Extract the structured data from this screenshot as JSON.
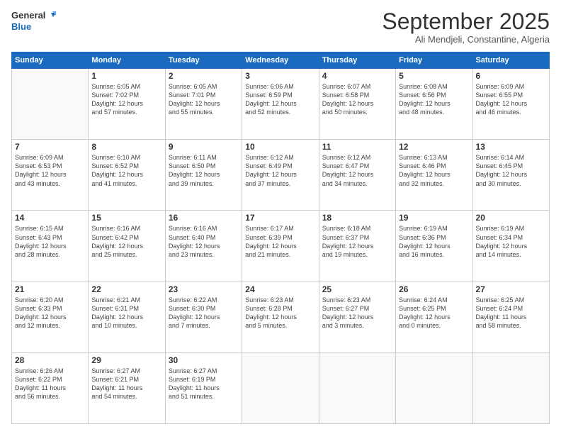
{
  "header": {
    "logo_line1": "General",
    "logo_line2": "Blue",
    "month_title": "September 2025",
    "subtitle": "Ali Mendjeli, Constantine, Algeria"
  },
  "days_of_week": [
    "Sunday",
    "Monday",
    "Tuesday",
    "Wednesday",
    "Thursday",
    "Friday",
    "Saturday"
  ],
  "weeks": [
    [
      {
        "day": "",
        "info": ""
      },
      {
        "day": "1",
        "info": "Sunrise: 6:05 AM\nSunset: 7:02 PM\nDaylight: 12 hours\nand 57 minutes."
      },
      {
        "day": "2",
        "info": "Sunrise: 6:05 AM\nSunset: 7:01 PM\nDaylight: 12 hours\nand 55 minutes."
      },
      {
        "day": "3",
        "info": "Sunrise: 6:06 AM\nSunset: 6:59 PM\nDaylight: 12 hours\nand 52 minutes."
      },
      {
        "day": "4",
        "info": "Sunrise: 6:07 AM\nSunset: 6:58 PM\nDaylight: 12 hours\nand 50 minutes."
      },
      {
        "day": "5",
        "info": "Sunrise: 6:08 AM\nSunset: 6:56 PM\nDaylight: 12 hours\nand 48 minutes."
      },
      {
        "day": "6",
        "info": "Sunrise: 6:09 AM\nSunset: 6:55 PM\nDaylight: 12 hours\nand 46 minutes."
      }
    ],
    [
      {
        "day": "7",
        "info": "Sunrise: 6:09 AM\nSunset: 6:53 PM\nDaylight: 12 hours\nand 43 minutes."
      },
      {
        "day": "8",
        "info": "Sunrise: 6:10 AM\nSunset: 6:52 PM\nDaylight: 12 hours\nand 41 minutes."
      },
      {
        "day": "9",
        "info": "Sunrise: 6:11 AM\nSunset: 6:50 PM\nDaylight: 12 hours\nand 39 minutes."
      },
      {
        "day": "10",
        "info": "Sunrise: 6:12 AM\nSunset: 6:49 PM\nDaylight: 12 hours\nand 37 minutes."
      },
      {
        "day": "11",
        "info": "Sunrise: 6:12 AM\nSunset: 6:47 PM\nDaylight: 12 hours\nand 34 minutes."
      },
      {
        "day": "12",
        "info": "Sunrise: 6:13 AM\nSunset: 6:46 PM\nDaylight: 12 hours\nand 32 minutes."
      },
      {
        "day": "13",
        "info": "Sunrise: 6:14 AM\nSunset: 6:45 PM\nDaylight: 12 hours\nand 30 minutes."
      }
    ],
    [
      {
        "day": "14",
        "info": "Sunrise: 6:15 AM\nSunset: 6:43 PM\nDaylight: 12 hours\nand 28 minutes."
      },
      {
        "day": "15",
        "info": "Sunrise: 6:16 AM\nSunset: 6:42 PM\nDaylight: 12 hours\nand 25 minutes."
      },
      {
        "day": "16",
        "info": "Sunrise: 6:16 AM\nSunset: 6:40 PM\nDaylight: 12 hours\nand 23 minutes."
      },
      {
        "day": "17",
        "info": "Sunrise: 6:17 AM\nSunset: 6:39 PM\nDaylight: 12 hours\nand 21 minutes."
      },
      {
        "day": "18",
        "info": "Sunrise: 6:18 AM\nSunset: 6:37 PM\nDaylight: 12 hours\nand 19 minutes."
      },
      {
        "day": "19",
        "info": "Sunrise: 6:19 AM\nSunset: 6:36 PM\nDaylight: 12 hours\nand 16 minutes."
      },
      {
        "day": "20",
        "info": "Sunrise: 6:19 AM\nSunset: 6:34 PM\nDaylight: 12 hours\nand 14 minutes."
      }
    ],
    [
      {
        "day": "21",
        "info": "Sunrise: 6:20 AM\nSunset: 6:33 PM\nDaylight: 12 hours\nand 12 minutes."
      },
      {
        "day": "22",
        "info": "Sunrise: 6:21 AM\nSunset: 6:31 PM\nDaylight: 12 hours\nand 10 minutes."
      },
      {
        "day": "23",
        "info": "Sunrise: 6:22 AM\nSunset: 6:30 PM\nDaylight: 12 hours\nand 7 minutes."
      },
      {
        "day": "24",
        "info": "Sunrise: 6:23 AM\nSunset: 6:28 PM\nDaylight: 12 hours\nand 5 minutes."
      },
      {
        "day": "25",
        "info": "Sunrise: 6:23 AM\nSunset: 6:27 PM\nDaylight: 12 hours\nand 3 minutes."
      },
      {
        "day": "26",
        "info": "Sunrise: 6:24 AM\nSunset: 6:25 PM\nDaylight: 12 hours\nand 0 minutes."
      },
      {
        "day": "27",
        "info": "Sunrise: 6:25 AM\nSunset: 6:24 PM\nDaylight: 11 hours\nand 58 minutes."
      }
    ],
    [
      {
        "day": "28",
        "info": "Sunrise: 6:26 AM\nSunset: 6:22 PM\nDaylight: 11 hours\nand 56 minutes."
      },
      {
        "day": "29",
        "info": "Sunrise: 6:27 AM\nSunset: 6:21 PM\nDaylight: 11 hours\nand 54 minutes."
      },
      {
        "day": "30",
        "info": "Sunrise: 6:27 AM\nSunset: 6:19 PM\nDaylight: 11 hours\nand 51 minutes."
      },
      {
        "day": "",
        "info": ""
      },
      {
        "day": "",
        "info": ""
      },
      {
        "day": "",
        "info": ""
      },
      {
        "day": "",
        "info": ""
      }
    ]
  ]
}
